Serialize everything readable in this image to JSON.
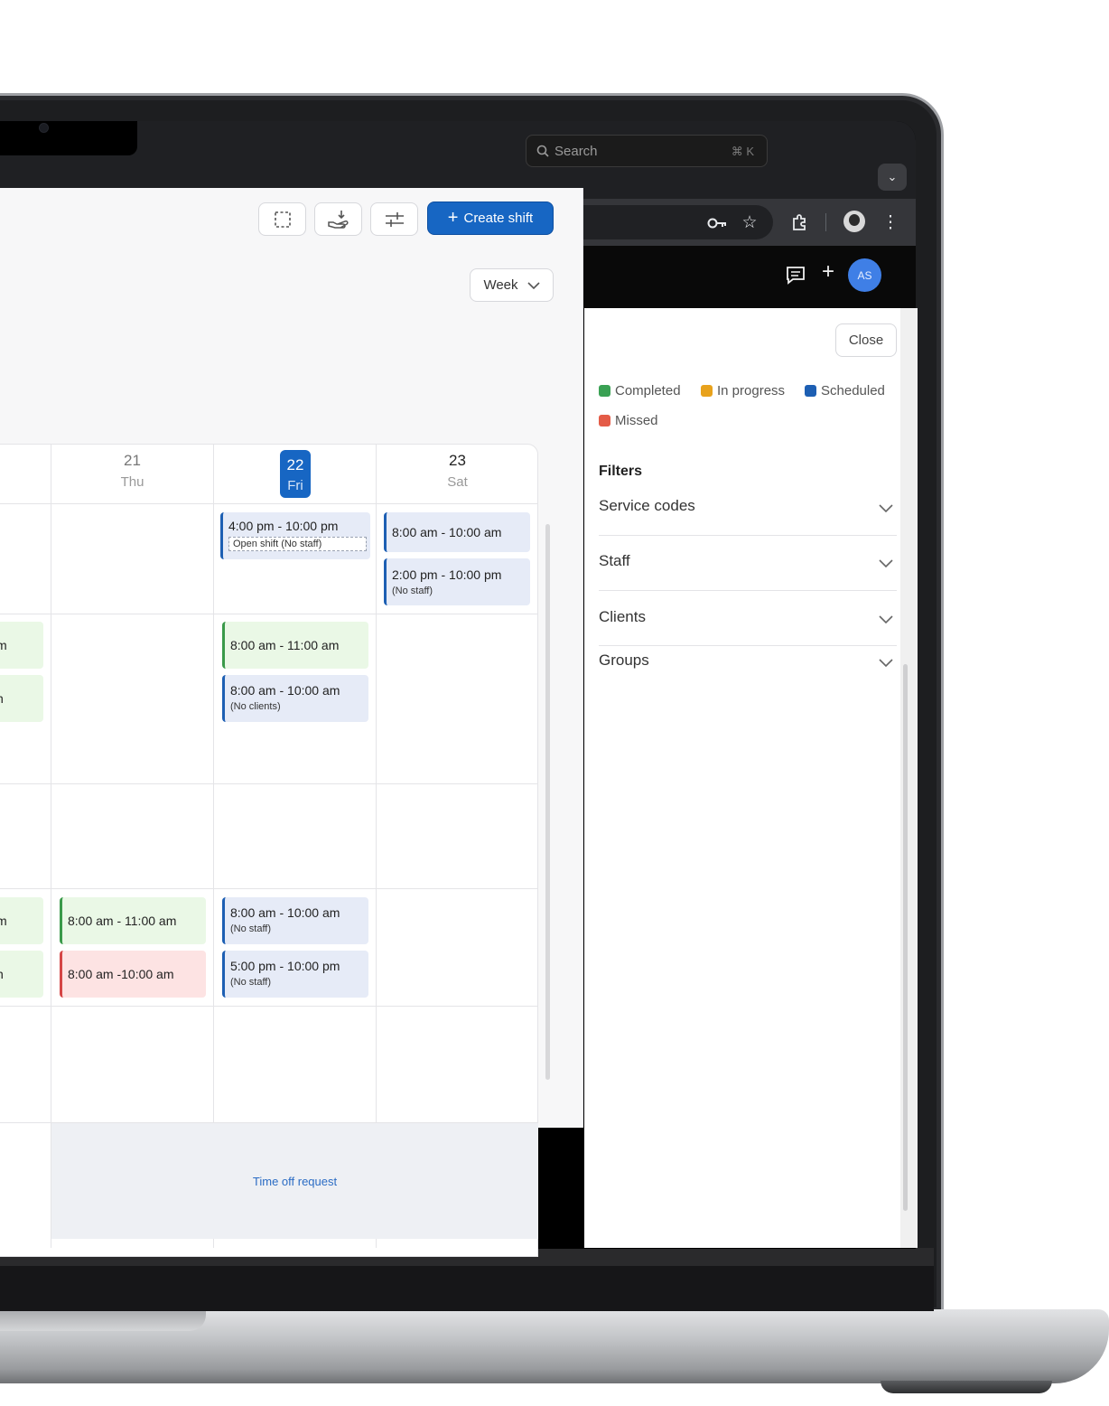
{
  "browser": {
    "tab_dropdown_icon": "chevron-down-icon"
  },
  "app": {
    "search_placeholder": "Search",
    "search_shortcut": "⌘ K",
    "avatar_initials": "AS",
    "create_shift_label": "Create shift",
    "view_label": "Week"
  },
  "days": [
    {
      "num": "21",
      "dow": "Thu"
    },
    {
      "num": "22",
      "dow": "Fri"
    },
    {
      "num": "23",
      "dow": "Sat"
    }
  ],
  "events": {
    "fri_r1_time": "4:00 pm - 10:00 pm",
    "fri_r1_note": "Open shift (No staff)",
    "sat_r1a_time": "8:00 am - 10:00 am",
    "sat_r1b_time": "2:00 pm - 10:00 pm",
    "sat_r1b_note": "(No staff)",
    "wed_r2a_time": "m",
    "wed_r2b_time": "n",
    "fri_r2a_time": "8:00 am - 11:00 am",
    "fri_r2b_time": "8:00 am - 10:00 am",
    "fri_r2b_note": "(No clients)",
    "wed_r4a_time": "m",
    "wed_r4b_time": "n",
    "thu_r4a_time": "8:00 am - 11:00 am",
    "thu_r4b_time": "8:00 am -10:00 am",
    "fri_r4a_time": "8:00 am - 10:00 am",
    "fri_r4a_note": "(No staff)",
    "fri_r4b_time": "5:00 pm - 10:00 pm",
    "fri_r4b_note": "(No staff)",
    "time_off": "Time off request"
  },
  "panel": {
    "close_label": "Close",
    "legend": [
      {
        "label": "Completed",
        "color": "#3aa154"
      },
      {
        "label": "In progress",
        "color": "#e8a21c"
      },
      {
        "label": "Scheduled",
        "color": "#1d5fb3"
      },
      {
        "label": "Missed",
        "color": "#e45b47"
      }
    ],
    "filters_title": "Filters",
    "filters": [
      "Service codes",
      "Staff",
      "Clients",
      "Groups"
    ]
  }
}
